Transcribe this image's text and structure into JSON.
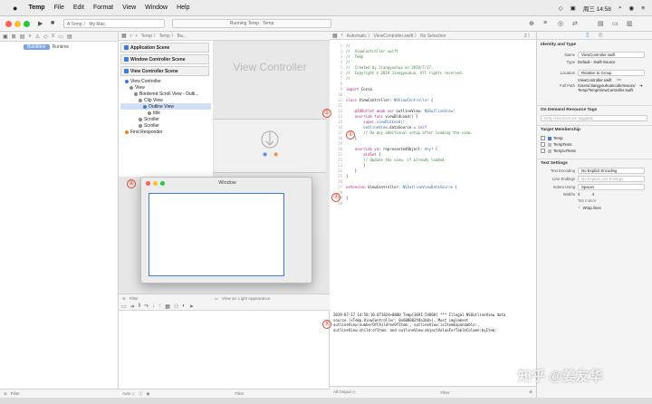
{
  "menubar": {
    "apple": "",
    "items": [
      "Temp",
      "File",
      "Edit",
      "Format",
      "View",
      "Window",
      "Help"
    ],
    "clock": "周三 14:58"
  },
  "toolbar": {
    "run": "▶",
    "stop": "■",
    "scheme": "A Temp 〉 My Mac",
    "status": "Running Temp : Temp"
  },
  "navigator": {
    "filter_tabs": [
      "Buildtime",
      "Runtime"
    ],
    "filter_placeholder": "Filter"
  },
  "storyboard_jumpbar": "Temp 〉 Temp 〉 Ba...",
  "outline": {
    "scenes": [
      {
        "label": "Application Scene"
      },
      {
        "label": "Window Controller Scene"
      },
      {
        "label": "View Controller Scene"
      }
    ],
    "items": [
      {
        "label": "View Controller",
        "indent": 1,
        "color": "#3b7dd8"
      },
      {
        "label": "View",
        "indent": 2,
        "color": "#888"
      },
      {
        "label": "Bordered Scroll View - Outli...",
        "indent": 3,
        "color": "#888"
      },
      {
        "label": "Clip View",
        "indent": 4,
        "color": "#888"
      },
      {
        "label": "Outline View",
        "indent": 5,
        "color": "#3b7dd8"
      },
      {
        "label": "title",
        "indent": 6,
        "color": "#888"
      },
      {
        "label": "Scroller",
        "indent": 4,
        "color": "#888"
      },
      {
        "label": "Scroller",
        "indent": 4,
        "color": "#888"
      },
      {
        "label": "First Responder",
        "indent": 1,
        "color": "#e08a2a"
      }
    ],
    "selected_index": 4
  },
  "canvas": {
    "vc_title": "View Controller",
    "view_as": "View as: Light Appearance"
  },
  "code_jumpbar": "Automatic 〉 ViewController.swift 〉 No Selection",
  "code_page": "2 〉",
  "code": {
    "lines": [
      {
        "n": "1",
        "parts": [
          {
            "t": "//",
            "c": "c-com"
          }
        ]
      },
      {
        "n": "2",
        "parts": [
          {
            "t": "//  ViewController.swift",
            "c": "c-com"
          }
        ]
      },
      {
        "n": "3",
        "parts": [
          {
            "t": "//  Temp",
            "c": "c-com"
          }
        ]
      },
      {
        "n": "4",
        "parts": [
          {
            "t": "//",
            "c": "c-com"
          }
        ]
      },
      {
        "n": "5",
        "parts": [
          {
            "t": "//  Created by Jiangyouhua on 2019/7/17.",
            "c": "c-com"
          }
        ]
      },
      {
        "n": "6",
        "parts": [
          {
            "t": "//  Copyright © 2019 Jiangyouhua. All rights reserved.",
            "c": "c-com"
          }
        ]
      },
      {
        "n": "7",
        "parts": [
          {
            "t": "//",
            "c": "c-com"
          }
        ]
      },
      {
        "n": "8",
        "parts": [
          {
            "t": "",
            "c": ""
          }
        ]
      },
      {
        "n": "9",
        "parts": [
          {
            "t": "import ",
            "c": "c-kw"
          },
          {
            "t": "Cocoa",
            "c": ""
          }
        ]
      },
      {
        "n": "10",
        "parts": [
          {
            "t": "",
            "c": ""
          }
        ]
      },
      {
        "n": "11",
        "parts": [
          {
            "t": "class ",
            "c": "c-kw"
          },
          {
            "t": "ViewController: ",
            "c": ""
          },
          {
            "t": "NSViewController",
            "c": "c-type"
          },
          {
            "t": " {",
            "c": ""
          }
        ]
      },
      {
        "n": "12",
        "parts": [
          {
            "t": "",
            "c": ""
          }
        ]
      },
      {
        "n": "13",
        "parts": [
          {
            "t": "    @IBOutlet weak var ",
            "c": "c-kw"
          },
          {
            "t": "outlineView: ",
            "c": ""
          },
          {
            "t": "NSOutlineView!",
            "c": "c-type"
          }
        ]
      },
      {
        "n": "14",
        "parts": [
          {
            "t": "    override func ",
            "c": "c-kw"
          },
          {
            "t": "viewDidLoad() {",
            "c": ""
          }
        ]
      },
      {
        "n": "15",
        "parts": [
          {
            "t": "        super",
            "c": "c-kw"
          },
          {
            "t": ".viewDidLoad()",
            "c": "c-type"
          }
        ]
      },
      {
        "n": "16",
        "parts": [
          {
            "t": "        outlineView",
            "c": "c-type"
          },
          {
            "t": ".dataSource = ",
            "c": ""
          },
          {
            "t": "self",
            "c": "c-kw"
          }
        ]
      },
      {
        "n": "17",
        "parts": [
          {
            "t": "        // Do any additional setup after loading the view.",
            "c": "c-com"
          }
        ]
      },
      {
        "n": "18",
        "parts": [
          {
            "t": "    }",
            "c": ""
          }
        ]
      },
      {
        "n": "19",
        "parts": [
          {
            "t": "",
            "c": ""
          }
        ]
      },
      {
        "n": "20",
        "parts": [
          {
            "t": "    override var ",
            "c": "c-kw"
          },
          {
            "t": "representedObject: ",
            "c": ""
          },
          {
            "t": "Any?",
            "c": "c-type"
          },
          {
            "t": " {",
            "c": ""
          }
        ]
      },
      {
        "n": "21",
        "parts": [
          {
            "t": "        didSet",
            "c": "c-kw"
          },
          {
            "t": " {",
            "c": ""
          }
        ]
      },
      {
        "n": "22",
        "parts": [
          {
            "t": "        // Update the view, if already loaded.",
            "c": "c-com"
          }
        ]
      },
      {
        "n": "23",
        "parts": [
          {
            "t": "        }",
            "c": ""
          }
        ]
      },
      {
        "n": "24",
        "parts": [
          {
            "t": "    }",
            "c": ""
          }
        ]
      },
      {
        "n": "25",
        "parts": [
          {
            "t": "}",
            "c": ""
          }
        ]
      },
      {
        "n": "26",
        "parts": [
          {
            "t": "",
            "c": ""
          }
        ]
      },
      {
        "n": "27",
        "parts": [
          {
            "t": "extension ",
            "c": "c-kw"
          },
          {
            "t": "ViewController: ",
            "c": ""
          },
          {
            "t": "NSOutlineViewDataSource",
            "c": "c-type"
          },
          {
            "t": " {",
            "c": ""
          }
        ]
      },
      {
        "n": "28",
        "parts": [
          {
            "t": "",
            "c": ""
          }
        ]
      },
      {
        "n": "29",
        "parts": [
          {
            "t": "}",
            "c": ""
          }
        ]
      },
      {
        "n": "30",
        "parts": [
          {
            "t": "",
            "c": ""
          }
        ]
      }
    ]
  },
  "debug": {
    "text": "2019-07-17 14:58:10.071824+0800 Temp[3691:54868] *** Illegal NSOutlineView data\nsource (<Temp.ViewController: 0x600002f0a1b0>). Must implement\noutlineView:numberOfChildrenOfItem:, outlineView:isItemExpandable:,\noutlineView:child:ofItem: and outlineView:objectValueForTableColumn:byItem:",
    "output_label": "All Output ◇",
    "filter_placeholder": "Filter",
    "auto_label": "Auto ◇"
  },
  "window_preview": {
    "title": "Window"
  },
  "inspector": {
    "identity_title": "Identity and Type",
    "rows": [
      {
        "label": "Name",
        "value": "ViewController.swift"
      },
      {
        "label": "Type",
        "value": "Default - Swift Source"
      },
      {
        "label": "Location",
        "value": "Relative to Group"
      },
      {
        "label": "",
        "value": "ViewController.swift"
      },
      {
        "label": "Full Path",
        "value": "/Users/Jiangyouhua/code/macos/Temp/Temp/ViewController.swift"
      }
    ],
    "odr_title": "On Demand Resource Tags",
    "odr_placeholder": "Only resources are taggable",
    "target_title": "Target Membership",
    "targets": [
      {
        "label": "Temp",
        "checked": true
      },
      {
        "label": "TempTests",
        "checked": false
      },
      {
        "label": "TempUITests",
        "checked": false
      }
    ],
    "text_title": "Text Settings",
    "text_rows": [
      {
        "label": "Text Encoding",
        "value": "No Explicit Encoding"
      },
      {
        "label": "Line Endings",
        "value": "No Explicit Line Endings"
      },
      {
        "label": "Indent Using",
        "value": "Spaces"
      },
      {
        "label": "Widths",
        "value": "4    4"
      },
      {
        "label": "",
        "value": "Tab        Indent"
      }
    ],
    "wrap_lines": "Wrap lines"
  },
  "markers": [
    "①",
    "②",
    "③",
    "④",
    "⑤"
  ],
  "watermark": "知乎 @姜友华"
}
